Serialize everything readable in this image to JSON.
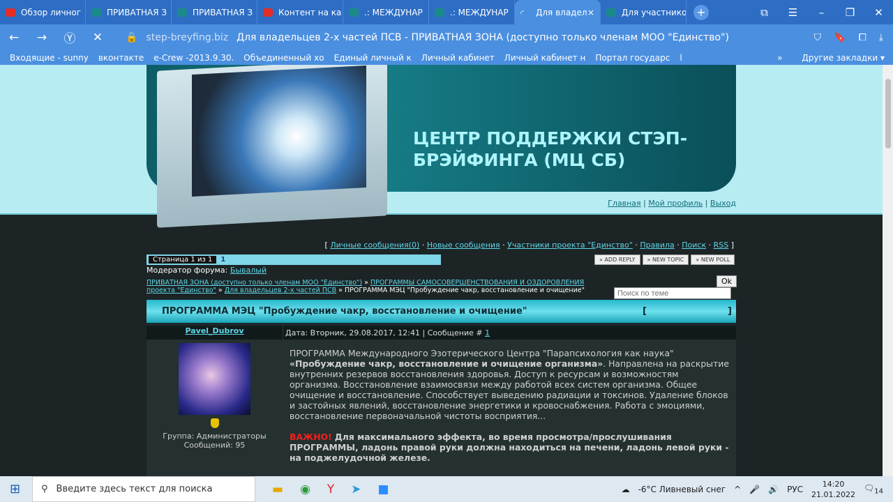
{
  "browser": {
    "tabs": [
      {
        "label": "Обзор личног",
        "icon": "youtube",
        "color": "#e52d27"
      },
      {
        "label": "ПРИВАТНАЯ З",
        "icon": "site",
        "color": "#1b8a8a"
      },
      {
        "label": "ПРИВАТНАЯ З",
        "icon": "site",
        "color": "#1b8a8a"
      },
      {
        "label": "Контент на ка",
        "icon": "youtube",
        "color": "#e52d27"
      },
      {
        "label": ".: МЕЖДУНАР",
        "icon": "site",
        "color": "#1b8a8a"
      },
      {
        "label": ".: МЕЖДУНАР",
        "icon": "site",
        "color": "#1b8a8a"
      },
      {
        "label": "Для владел",
        "icon": "loading",
        "color": "#ffffff",
        "active": true
      },
      {
        "label": "Для участнико",
        "icon": "site",
        "color": "#1b8a8a"
      }
    ],
    "close_tab": "×",
    "new_tab": "+",
    "url_domain": "step-breyfing.biz",
    "page_title": "Для владельцев 2-х частей ПСВ - ПРИВАТНАЯ ЗОНА (доступно только членам МОО \"Единство\")",
    "bookmarks": [
      "Входящие - sunny",
      "вконтакте",
      "e-Crew -2013.9.30.",
      "Объединенный хо",
      "Единый личный к",
      "Личный кабинет",
      "Личный кабинет н",
      "Портал государс",
      "l"
    ],
    "more": "»",
    "other_bookmarks": "Другие закладки ▾"
  },
  "site": {
    "banner_title": "ЦЕНТР ПОДДЕРЖКИ СТЭП-БРЭЙФИНГА (МЦ СБ)",
    "top_links": [
      "Главная",
      "Мой профиль",
      "Выход"
    ],
    "nav_links": [
      "Личные сообщения(0)",
      "Новые сообщения",
      "Участники проекта \"Единство\"",
      "Правила",
      "Поиск",
      "RSS"
    ],
    "pager_label": "Страница 1 из 1",
    "pager_current": "1",
    "buttons": [
      "» ADD REPLY",
      "» NEW TOPIC",
      "» NEW POLL"
    ],
    "moderator_label": "Модератор форума:",
    "moderator": "Бывалый",
    "breadcrumbs": [
      "ПРИВАТНАЯ ЗОНА (доступно только членам МОО \"Единство\")",
      "ПРОГРАММЫ САМОСОВЕРШЕНСТВОВАНИЯ И ОЗДОРОВЛЕНИЯ проекта \"Единство\"",
      "Для владельцев 2-х частей ПСВ"
    ],
    "breadcrumb_current": "ПРОГРАММА МЭЦ \"Пробуждение чакр, восстановление и очищение\"",
    "ok": "Ok",
    "search_placeholder": "Поиск по теме",
    "topic_title": "ПРОГРАММА МЭЦ \"Пробуждение чакр, восстановление и очищение\"",
    "post": {
      "author": "Pavel_Dubrov",
      "group": "Группа: Администраторы",
      "count": "Сообщений: 95",
      "date": "Дата: Вторник, 29.08.2017, 12:41 | Сообщение #",
      "num": "1",
      "p1": "ПРОГРАММА Международного Эзотерического Центра \"Парапсихология как наука\"",
      "p1_bold": "«Пробуждение чакр, восстановление и очищение организма»",
      "p1_rest": ". Направлена на раскрытие внутренних резервов восстановления здоровья. Доступ к ресурсам и возможностям организма. Восстановление взаимосвязи между работой всех систем организма. Общее очищение и восстановление. Способствует выведению радиации и токсинов. Удаление блоков и застойных явлений, восстановление энергетики и кровоснабжения. Работа с эмоциями, восстановление первоначальной чистоты восприятия...",
      "important": "ВАЖНО!",
      "important_text": "Для максимального эффекта, во время просмотра/прослушивания ПРОГРАММЫ, ладонь правой руки должна находиться на печени, ладонь левой руки - на поджелудочной железе."
    }
  },
  "taskbar": {
    "search_placeholder": "Введите здесь текст для поиска",
    "weather": "-6°C  Ливневый снег",
    "lang": "РУС",
    "time": "14:20",
    "date": "21.01.2022",
    "notifications": "14"
  }
}
